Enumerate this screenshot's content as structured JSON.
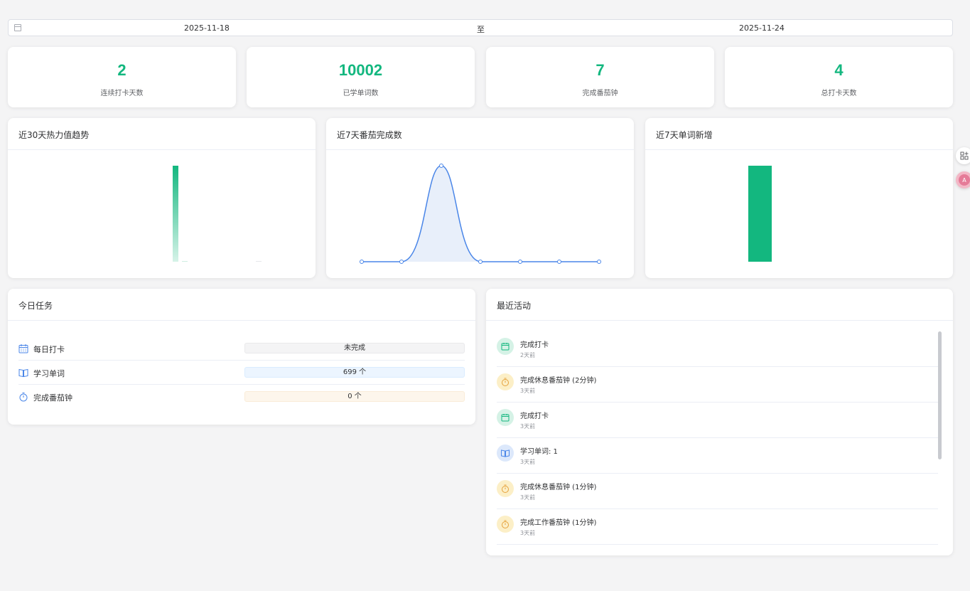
{
  "date_range": {
    "start": "2025-11-18",
    "separator": "至",
    "end": "2025-11-24"
  },
  "stats": [
    {
      "value": "2",
      "label": "连续打卡天数"
    },
    {
      "value": "10002",
      "label": "已学单词数"
    },
    {
      "value": "7",
      "label": "完成番茄钟"
    },
    {
      "value": "4",
      "label": "总打卡天数"
    }
  ],
  "charts": {
    "heat": {
      "title": "近30天热力值趋势"
    },
    "pomodoro": {
      "title": "近7天番茄完成数"
    },
    "words": {
      "title": "近7天单词新增"
    }
  },
  "chart_data": [
    {
      "type": "bar",
      "title": "近30天热力值趋势",
      "bars": [
        1,
        0.01,
        0.005
      ],
      "color": "#13b77f"
    },
    {
      "type": "area",
      "title": "近7天番茄完成数",
      "values": [
        0,
        0,
        1,
        0,
        0,
        0,
        0
      ],
      "color": "#4a86e8"
    },
    {
      "type": "bar",
      "title": "近7天单词新增",
      "values": [
        1
      ],
      "color": "#13b77f"
    }
  ],
  "tasks": {
    "title": "今日任务",
    "items": [
      {
        "name": "每日打卡",
        "status": "未完成",
        "icon": "calendar-icon"
      },
      {
        "name": "学习单词",
        "status": "699 个",
        "icon": "book-icon"
      },
      {
        "name": "完成番茄钟",
        "status": "0 个",
        "icon": "timer-icon"
      }
    ]
  },
  "activities": {
    "title": "最近活动",
    "items": [
      {
        "text": "完成打卡",
        "time": "2天前",
        "kind": "checkin"
      },
      {
        "text": "完成休息番茄钟 (2分钟)",
        "time": "3天前",
        "kind": "pomodoro"
      },
      {
        "text": "完成打卡",
        "time": "3天前",
        "kind": "checkin"
      },
      {
        "text": "学习单词: 1",
        "time": "3天前",
        "kind": "word"
      },
      {
        "text": "完成休息番茄钟 (1分钟)",
        "time": "3天前",
        "kind": "pomodoro"
      },
      {
        "text": "完成工作番茄钟 (1分钟)",
        "time": "3天前",
        "kind": "pomodoro"
      }
    ]
  }
}
